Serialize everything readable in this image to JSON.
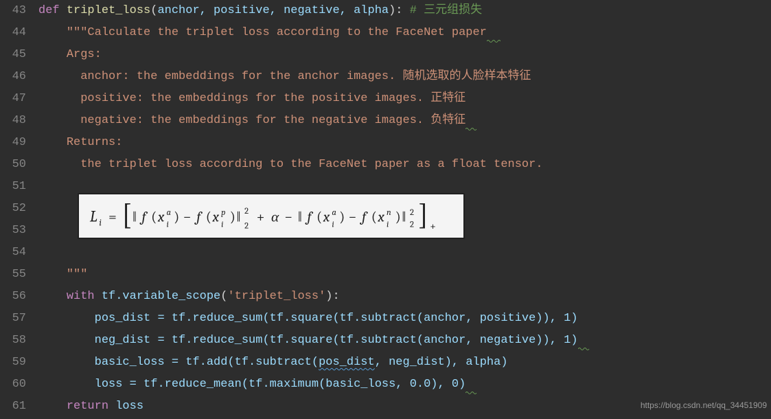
{
  "line_start": 43,
  "line_end": 61,
  "code": {
    "l43_def": "def",
    "l43_fn": "triplet_loss",
    "l43_args": "anchor, positive, negative, alpha",
    "l43_cmt": "# 三元组损失",
    "l44": "\"\"\"Calculate the triplet loss according to the FaceNet paper",
    "l45": "Args:",
    "l46": "  anchor: the embeddings for the anchor images. 随机选取的人脸样本特征",
    "l47": "  positive: the embeddings for the positive images. 正特征",
    "l48": "  negative: the embeddings for the negative images. 负特征",
    "l49": "Returns:",
    "l50": "  the triplet loss according to the FaceNet paper as a float tensor.",
    "l55": "\"\"\"",
    "l56_with": "with",
    "l56_call": "tf.variable_scope",
    "l56_str": "'triplet_loss'",
    "l57": "pos_dist = tf.reduce_sum(tf.square(tf.subtract(anchor, positive)), 1)",
    "l58": "neg_dist = tf.reduce_sum(tf.square(tf.subtract(anchor, negative)), 1)",
    "l59_a": "basic_loss = tf.add(tf.subtract(",
    "l59_underlined": "pos_dist",
    "l59_b": ", neg_dist), alpha)",
    "l60": "loss = tf.reduce_mean(tf.maximum(basic_loss, 0.0), 0)",
    "l61_ret": "return",
    "l61_val": "loss"
  },
  "formula": {
    "text": "L_i = [ ||f(x_i^a) - f(x_i^p)||_2^2 + α - ||f(x_i^a) - f(x_i^n)||_2^2 ]_+"
  },
  "watermark": "https://blog.csdn.net/qq_34451909"
}
